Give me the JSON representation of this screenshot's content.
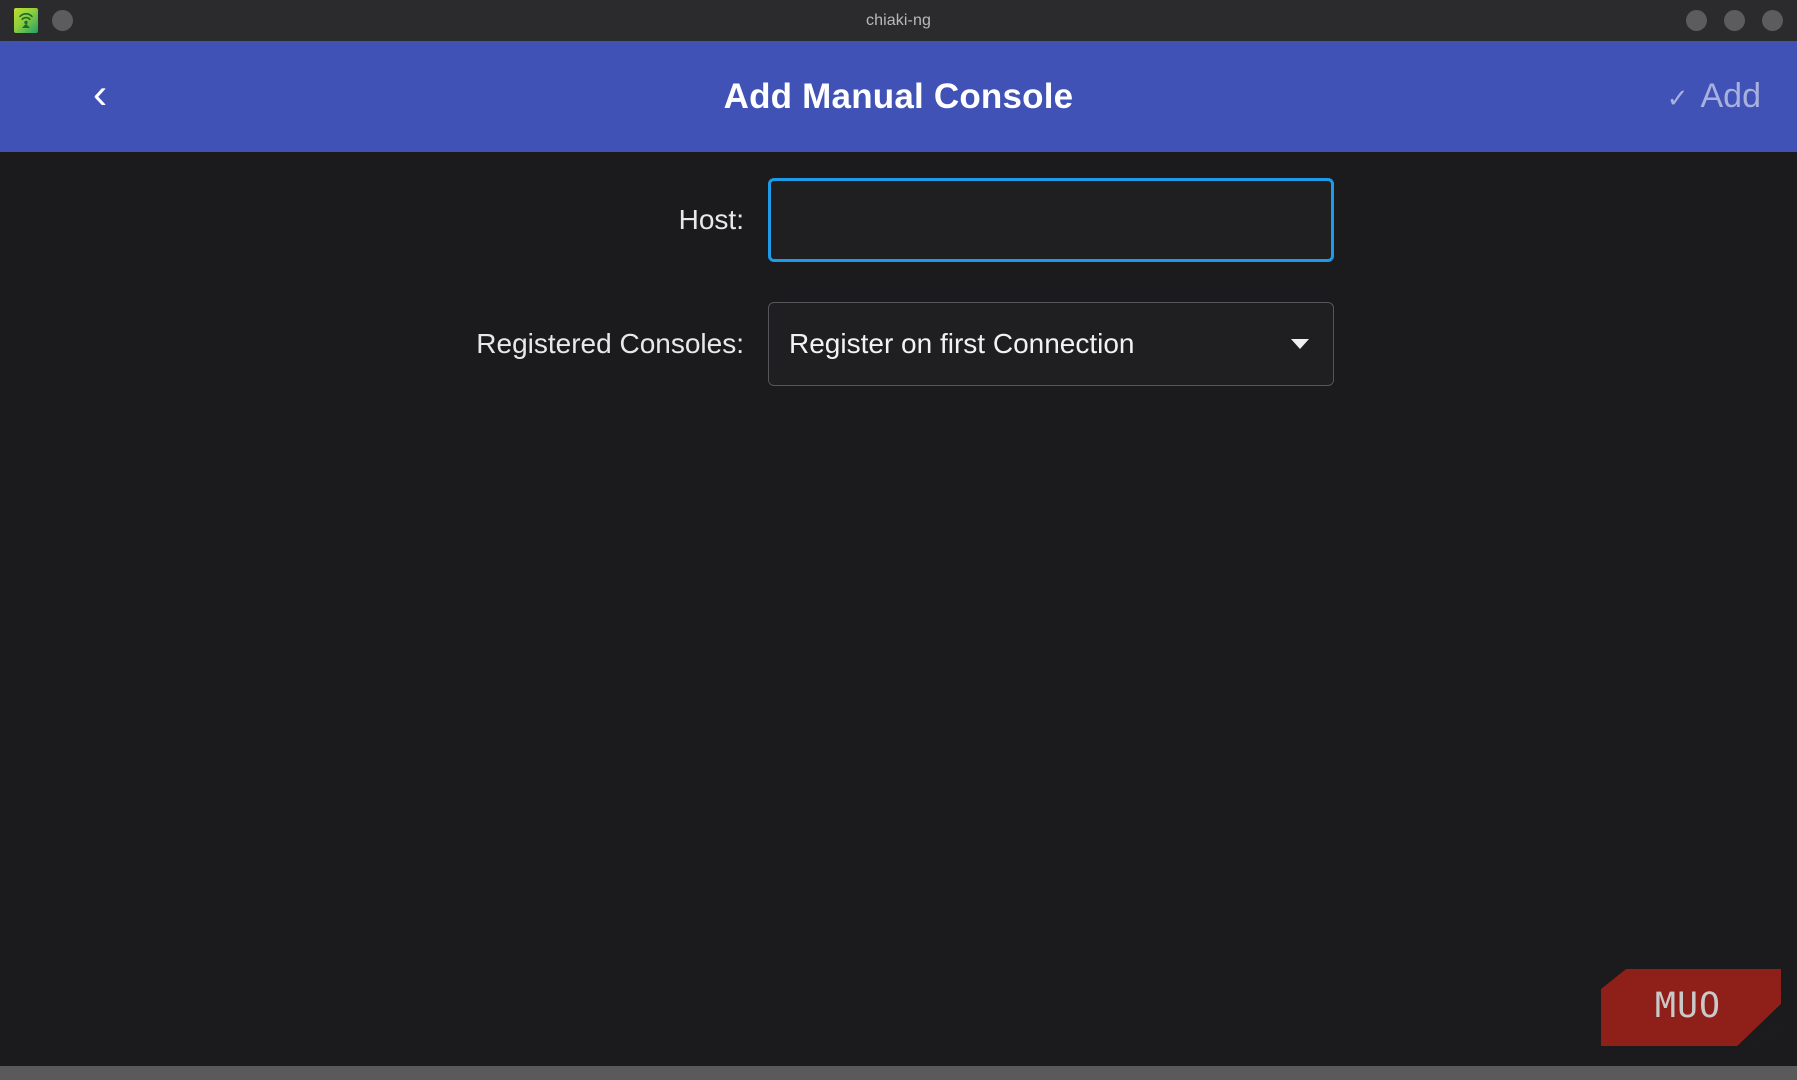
{
  "titlebar": {
    "app_icon": "chiaki-wifi-icon",
    "title": "chiaki-ng",
    "window_controls": [
      "minimize-dot",
      "maximize-dot",
      "close-dot"
    ]
  },
  "header": {
    "back_icon": "‹",
    "title": "Add Manual Console",
    "add_check": "✓",
    "add_label": "Add",
    "accent_color": "#4052b5",
    "add_color": "#a8b1de"
  },
  "form": {
    "host": {
      "label": "Host:",
      "value": "",
      "placeholder": "",
      "focus_border_color": "#1e9be8"
    },
    "registered_consoles": {
      "label": "Registered Consoles:",
      "value": "Register on first Connection",
      "options": [
        "Register on first Connection"
      ],
      "arrow_icon": "▼"
    }
  },
  "watermark": {
    "text": "MUO",
    "color": "#8e2019"
  },
  "theme": {
    "window_background": "#1b1b1e",
    "titlebar_background": "#2b2b2d",
    "desktop_background": "#5a5a5a",
    "text_color": "#e8e8e8"
  }
}
